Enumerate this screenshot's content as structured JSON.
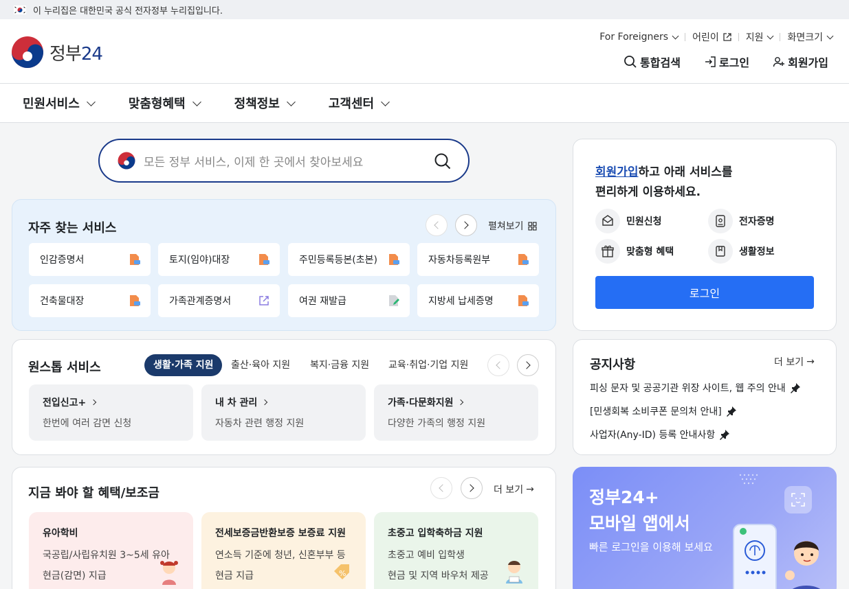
{
  "gov_banner": {
    "text": "이 누리집은 대한민국 공식 전자정부 누리집입니다."
  },
  "logo": {
    "text_main": "정부",
    "text_num": "24"
  },
  "utility": [
    {
      "label": "For Foreigners",
      "icon": "chevron-down-icon"
    },
    {
      "label": "어린이",
      "icon": "external-link-icon"
    },
    {
      "label": "지원",
      "icon": "chevron-down-icon"
    },
    {
      "label": "화면크기",
      "icon": "chevron-down-icon"
    }
  ],
  "header_actions": {
    "search": "통합검색",
    "login": "로그인",
    "signup": "회원가입"
  },
  "gnb": [
    "민원서비스",
    "맞춤형혜택",
    "정책정보",
    "고객센터"
  ],
  "search": {
    "placeholder": "모든 정부 서비스, 이제 한 곳에서 찾아보세요"
  },
  "frequent": {
    "title": "자주 찾는 서비스",
    "expand": "펼쳐보기",
    "items": [
      {
        "label": "인감증명서",
        "icon": "document-icon"
      },
      {
        "label": "토지(임야)대장",
        "icon": "document-icon"
      },
      {
        "label": "주민등록등본(초본)",
        "icon": "document-icon"
      },
      {
        "label": "자동차등록원부",
        "icon": "document-icon"
      },
      {
        "label": "건축물대장",
        "icon": "document-icon"
      },
      {
        "label": "가족관계증명서",
        "icon": "external-link-icon"
      },
      {
        "label": "여권 재발급",
        "icon": "edit-document-icon"
      },
      {
        "label": "지방세 납세증명",
        "icon": "document-icon"
      }
    ]
  },
  "onestop": {
    "title": "원스톱 서비스",
    "tabs": [
      "생활·가족 지원",
      "출산·육아 지원",
      "복지·금융 지원",
      "교육·취업·기업 지원"
    ],
    "cards": [
      {
        "title": "전입신고+",
        "desc": "한번에 여러 감면 신청"
      },
      {
        "title": "내 차 관리",
        "desc": "자동차 관련 행정 지원"
      },
      {
        "title": "가족·다문화지원",
        "desc": "다양한 가족의 행정 지원"
      }
    ]
  },
  "benefits": {
    "title": "지금 봐야 할 혜택/보조금",
    "more": "더 보기",
    "cards": [
      {
        "title": "유아학비",
        "line1": "국공립/사립유치원 3~5세 유아",
        "line2": "현금(감면) 지급",
        "bg": "#fdecec"
      },
      {
        "title": "전세보증금반환보증 보증료 지원",
        "line1": "연소득 기준에 청년, 신혼부부 등",
        "line2": "현금 지급",
        "bg": "#fdf2e0"
      },
      {
        "title": "초중고 입학축하금 지원",
        "line1": "초중고 예비 입학생",
        "line2": "현금 및 지역 바우처 제공",
        "bg": "#eaf5ea"
      }
    ]
  },
  "join": {
    "line1_link": "회원가입",
    "line1_rest": "하고 아래 서비스를",
    "line2": "편리하게 이용하세요.",
    "items": [
      {
        "label": "민원신청",
        "icon": "mail-icon"
      },
      {
        "label": "전자증명",
        "icon": "id-card-icon"
      },
      {
        "label": "맞춤형 혜택",
        "icon": "gift-icon"
      },
      {
        "label": "생활정보",
        "icon": "bookmark-icon"
      }
    ],
    "login_button": "로그인"
  },
  "notice": {
    "title": "공지사항",
    "more": "더 보기",
    "items": [
      "피싱 문자 및 공공기관 위장 사이트, 웹 주의 안내",
      "[민생회복 소비쿠폰 문의처 안내]",
      "사업자(Any-ID) 등록 안내사항"
    ]
  },
  "promo": {
    "line1": "정부24+",
    "line2": "모바일 앱에서",
    "sub": "빠른 로그인을 이용해 보세요"
  },
  "colors": {
    "brand_navy": "#1a3a8a",
    "login_blue": "#256ef4",
    "tab_active": "#1b3a6b"
  }
}
